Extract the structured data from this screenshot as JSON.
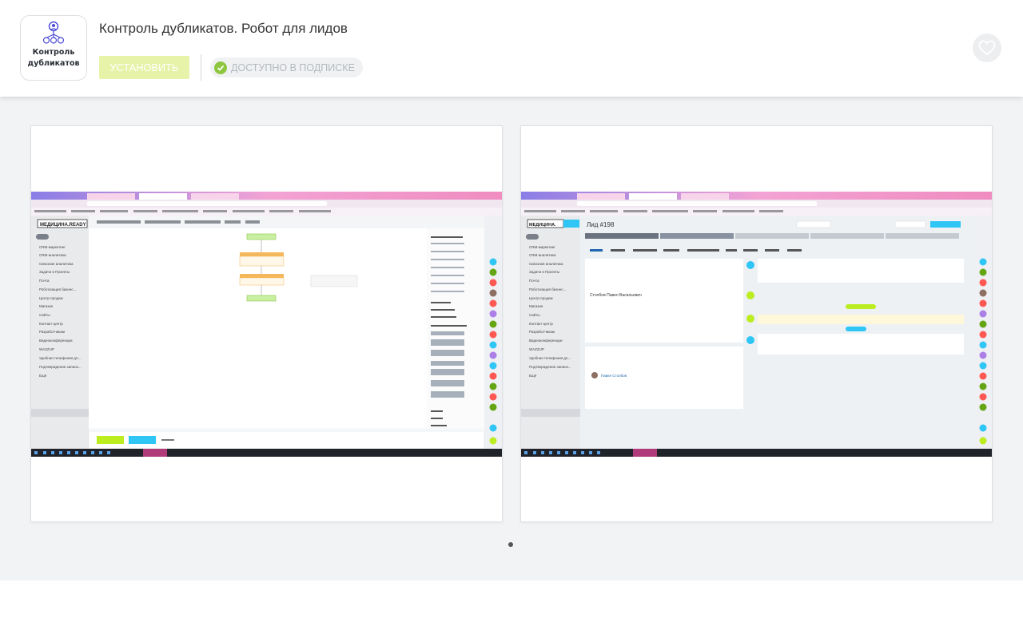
{
  "app": {
    "title": "Контроль дубликатов. Робот для лидов",
    "logo_text_line1": "Контроль",
    "logo_text_line2": "дубликатов",
    "logo_icon": "network-people-icon"
  },
  "actions": {
    "install_label": "УСТАНОВИТЬ",
    "subscription_label": "ДОСТУПНО В ПОДПИСКЕ",
    "favorite_icon": "heart-icon"
  },
  "gallery": {
    "active_index": 0,
    "dots_count": 1,
    "screenshots": [
      {
        "desc": "robot-workflow-editor",
        "sidebar_brand": "МЕДИЦИНА.READY",
        "sidebar_items": [
          "CRM-маркетинг",
          "CRM-аналитика",
          "Сквозная аналитика",
          "Задачи и Проекты",
          "Почта",
          "Роботизация бизнес...",
          "Центр продаж",
          "Магазин",
          "Сайты",
          "Контакт-центр",
          "Разработчикам",
          "Видеоконференции",
          "WAZZUP",
          "Удобная телефония дл...",
          "Подтверждение записи...",
          "Ещё"
        ],
        "toolbar_items": [
          "Параметры шаблона",
          "Список шаблонов",
          "Создать шаблон",
          "Экспорт",
          "Импорт"
        ],
        "flow_nodes": [
          "Начало",
          "Контроль дубликатов. Робот для лидов [WAZZUP]",
          "Запись в отчет",
          "Конец"
        ],
        "right_panel_groups": [
          "Обработка документа",
          "Задания",
          "Конструкции",
          "Уведомления",
          "Действия приложений",
          "CRM",
          "Диск",
          "Прочее"
        ],
        "bottom_buttons": [
          "СОХРАНИТЬ",
          "ПРИМЕНИТЬ",
          "ОТМЕНА"
        ]
      },
      {
        "desc": "lead-card",
        "lead_title": "Лид #198",
        "stages": [
          "Текущее обращение",
          "Проведенный звонок",
          "Записан к консультации",
          "Пациент согласился",
          "Завершить обработку лида"
        ],
        "tabs": [
          "Общие",
          "Товары",
          "Предложения",
          "Роботы",
          "Бизнес-процессы",
          "Связи",
          "История",
          "WAZZUP",
          "Маркет"
        ],
        "contact_name": "Столбов Павел Васильевич",
        "responsible": "Павел Столбов",
        "comment_tabs": [
          "Комментарий",
          "Задача",
          "SMS",
          "Письмо",
          "Ждать",
          "Zoom",
          "Встреча",
          "Звонок",
          "Визит",
          "WAZZUP",
          "Ещё"
        ],
        "top_buttons": [
          "РАСШИРЕНИЯ",
          "ДОКУМЕНТ",
          "ЗДЕЛКА"
        ]
      }
    ]
  },
  "colors": {
    "install_bg": "#e6f3a9",
    "subscription_check": "#8ec63f",
    "bitrix_blue": "#2fc6f6",
    "bitrix_green": "#bbed21"
  }
}
